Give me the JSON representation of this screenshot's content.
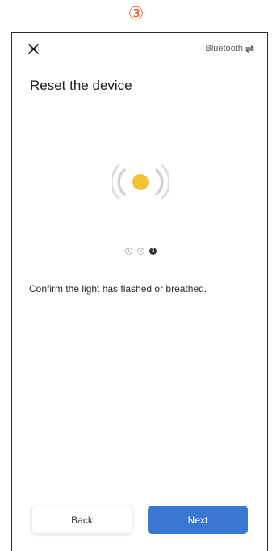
{
  "step_marker": "③",
  "header": {
    "close_icon": "close-icon",
    "bluetooth_label": "Bluetooth",
    "bluetooth_icon": "swap-arrows-icon"
  },
  "main": {
    "title": "Reset the device",
    "illustration_icon": "flashing-light-icon",
    "light_color": "#f3c234",
    "steps": [
      "1",
      "2",
      "3"
    ],
    "current_step": 3,
    "instruction": "Confirm the light has flashed or breathed."
  },
  "footer": {
    "back_label": "Back",
    "next_label": "Next",
    "accent_color": "#3a77d0"
  }
}
